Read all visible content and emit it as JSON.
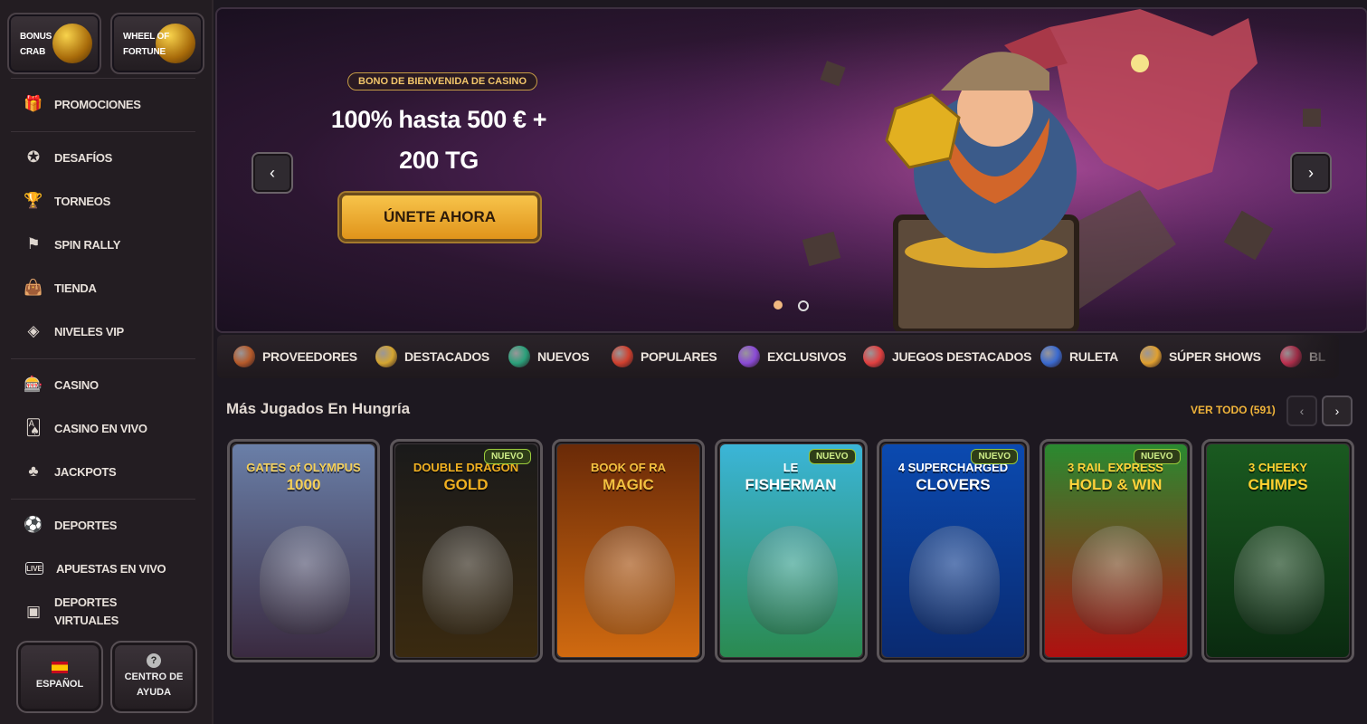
{
  "top_cards": [
    {
      "label_line1": "BONUS",
      "label_line2": "CRAB"
    },
    {
      "label_line1": "WHEEL OF",
      "label_line2": "FORTUNE"
    }
  ],
  "nav": {
    "group1": [
      {
        "label": "PROMOCIONES",
        "icon": "gift-icon",
        "glyph": "🎁"
      }
    ],
    "group2": [
      {
        "label": "DESAFÍOS",
        "icon": "medal-icon",
        "glyph": "✪"
      },
      {
        "label": "TORNEOS",
        "icon": "trophy-icon",
        "glyph": "🏆"
      },
      {
        "label": "SPIN RALLY",
        "icon": "rally-icon",
        "glyph": "⚑"
      },
      {
        "label": "TIENDA",
        "icon": "shopping-bag-icon",
        "glyph": "👜"
      },
      {
        "label": "NIVELES VIP",
        "icon": "diamond-icon",
        "glyph": "◈"
      }
    ],
    "group3": [
      {
        "label": "CASINO",
        "icon": "slot-machine-icon",
        "glyph": "🎰"
      },
      {
        "label": "CASINO EN VIVO",
        "icon": "card-icon",
        "glyph": "🂡"
      },
      {
        "label": "JACKPOTS",
        "icon": "clover-icon",
        "glyph": "♣"
      }
    ],
    "group4": [
      {
        "label": "DEPORTES",
        "icon": "basketball-icon",
        "glyph": "⚽"
      },
      {
        "label": "APUESTAS EN VIVO",
        "icon": "live-icon",
        "glyph": "LIVE"
      },
      {
        "label_line1": "DEPORTES",
        "label_line2": "VIRTUALES",
        "icon": "virtual-sports-icon",
        "glyph": "▣"
      }
    ]
  },
  "bottom_buttons": {
    "language": "ESPAÑOL",
    "help_line1": "CENTRO DE",
    "help_line2": "AYUDA",
    "help_glyph": "?"
  },
  "banner": {
    "badge": "BONO DE BIENVENIDA DE CASINO",
    "headline_line1": "100% hasta 500 € +",
    "headline_line2": "200 TG",
    "cta": "ÚNETE AHORA",
    "prev_glyph": "‹",
    "next_glyph": "›",
    "slides": 2,
    "active_slide": 1
  },
  "categories": [
    {
      "label": "PROVEEDORES",
      "color": "#b55a2a"
    },
    {
      "label": "DESTACADOS",
      "color": "#d4a531"
    },
    {
      "label": "NUEVOS",
      "color": "#2aa07a"
    },
    {
      "label": "POPULARES",
      "color": "#d0402e"
    },
    {
      "label": "EXCLUSIVOS",
      "color": "#8a4ad6"
    },
    {
      "label": "JUEGOS DESTACADOS",
      "color": "#e04040"
    },
    {
      "label": "RULETA",
      "color": "#3a6ad0"
    },
    {
      "label": "SÚPER SHOWS",
      "color": "#e0a030"
    },
    {
      "label": "BL",
      "color": "#c03050"
    }
  ],
  "section": {
    "title": "Más Jugados En Hungría",
    "see_all": "VER TODO (591)",
    "prev_glyph": "‹",
    "next_glyph": "›"
  },
  "games": [
    {
      "title_line1": "GATES of OLYMPUS",
      "title_line2": "1000",
      "new": "",
      "bg1": "#6a7fa8",
      "bg2": "#3a2a40",
      "fg": "#f3cf5a"
    },
    {
      "title_line1": "DOUBLE DRAGON",
      "title_line2": "GOLD",
      "new": "NUEVO",
      "bg1": "#1a1a1a",
      "bg2": "#3a2a10",
      "fg": "#f0b020"
    },
    {
      "title_line1": "BOOK OF RA",
      "title_line2": "MAGIC",
      "new": "",
      "bg1": "#6a2a08",
      "bg2": "#d06a10",
      "fg": "#f2c040"
    },
    {
      "title_line1": "LE",
      "title_line2": "FISHERMAN",
      "new": "NUEVO",
      "bg1": "#3bb5d8",
      "bg2": "#2a8a50",
      "fg": "#ffffff"
    },
    {
      "title_line1": "4 SUPERCHARGED",
      "title_line2": "CLOVERS",
      "new": "NUEVO",
      "bg1": "#0b4ab0",
      "bg2": "#0a2a70",
      "fg": "#ffffff"
    },
    {
      "title_line1": "3 RAIL EXPRESS",
      "title_line2": "HOLD & WIN",
      "new": "NUEVO",
      "bg1": "#2a8a30",
      "bg2": "#b01010",
      "fg": "#ffd23a"
    },
    {
      "title_line1": "3 CHEEKY",
      "title_line2": "CHIMPS",
      "new": "",
      "bg1": "#1a5a20",
      "bg2": "#0a2a10",
      "fg": "#ffd030"
    }
  ]
}
